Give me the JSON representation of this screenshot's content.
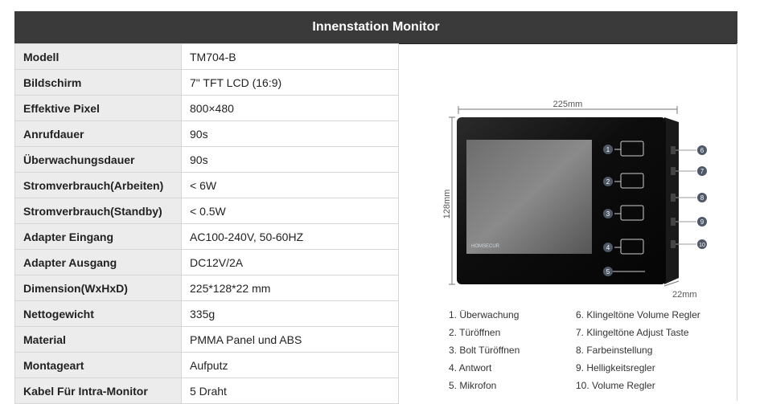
{
  "header": {
    "title": "Innenstation Monitor"
  },
  "specs": [
    {
      "label": "Modell",
      "value": "TM704-B"
    },
    {
      "label": "Bildschirm",
      "value": "7\" TFT LCD (16:9)"
    },
    {
      "label": "Effektive Pixel",
      "value": "800×480"
    },
    {
      "label": "Anrufdauer",
      "value": "90s"
    },
    {
      "label": "Überwachungsdauer",
      "value": "90s"
    },
    {
      "label": "Stromverbrauch(Arbeiten)",
      "value": "< 6W"
    },
    {
      "label": "Stromverbrauch(Standby)",
      "value": "< 0.5W"
    },
    {
      "label": "Adapter Eingang",
      "value": "AC100-240V, 50-60HZ"
    },
    {
      "label": "Adapter Ausgang",
      "value": "DC12V/2A"
    },
    {
      "label": "Dimension(WxHxD)",
      "value": "225*128*22 mm"
    },
    {
      "label": "Nettogewicht",
      "value": "335g"
    },
    {
      "label": "Material",
      "value": "PMMA Panel und ABS"
    },
    {
      "label": "Montageart",
      "value": "Aufputz"
    },
    {
      "label": "Kabel Für Intra-Monitor",
      "value": "5 Draht"
    }
  ],
  "diagram": {
    "width_label": "225mm",
    "height_label": "128mm",
    "depth_label": "22mm",
    "brand": "HOMSECUR",
    "front_callouts": [
      "1",
      "2",
      "3",
      "4",
      "5"
    ],
    "side_callouts": [
      "6",
      "7",
      "8",
      "9",
      "10"
    ]
  },
  "legend": [
    "1. Überwachung",
    "6. Klingeltöne Volume Regler",
    "2. Türöffnen",
    "7. Klingeltöne Adjust Taste",
    "3. Bolt Türöffnen",
    "8. Farbeinstellung",
    "4. Antwort",
    "9. Helligkeitsregler",
    "5. Mikrofon",
    "10. Volume Regler"
  ]
}
